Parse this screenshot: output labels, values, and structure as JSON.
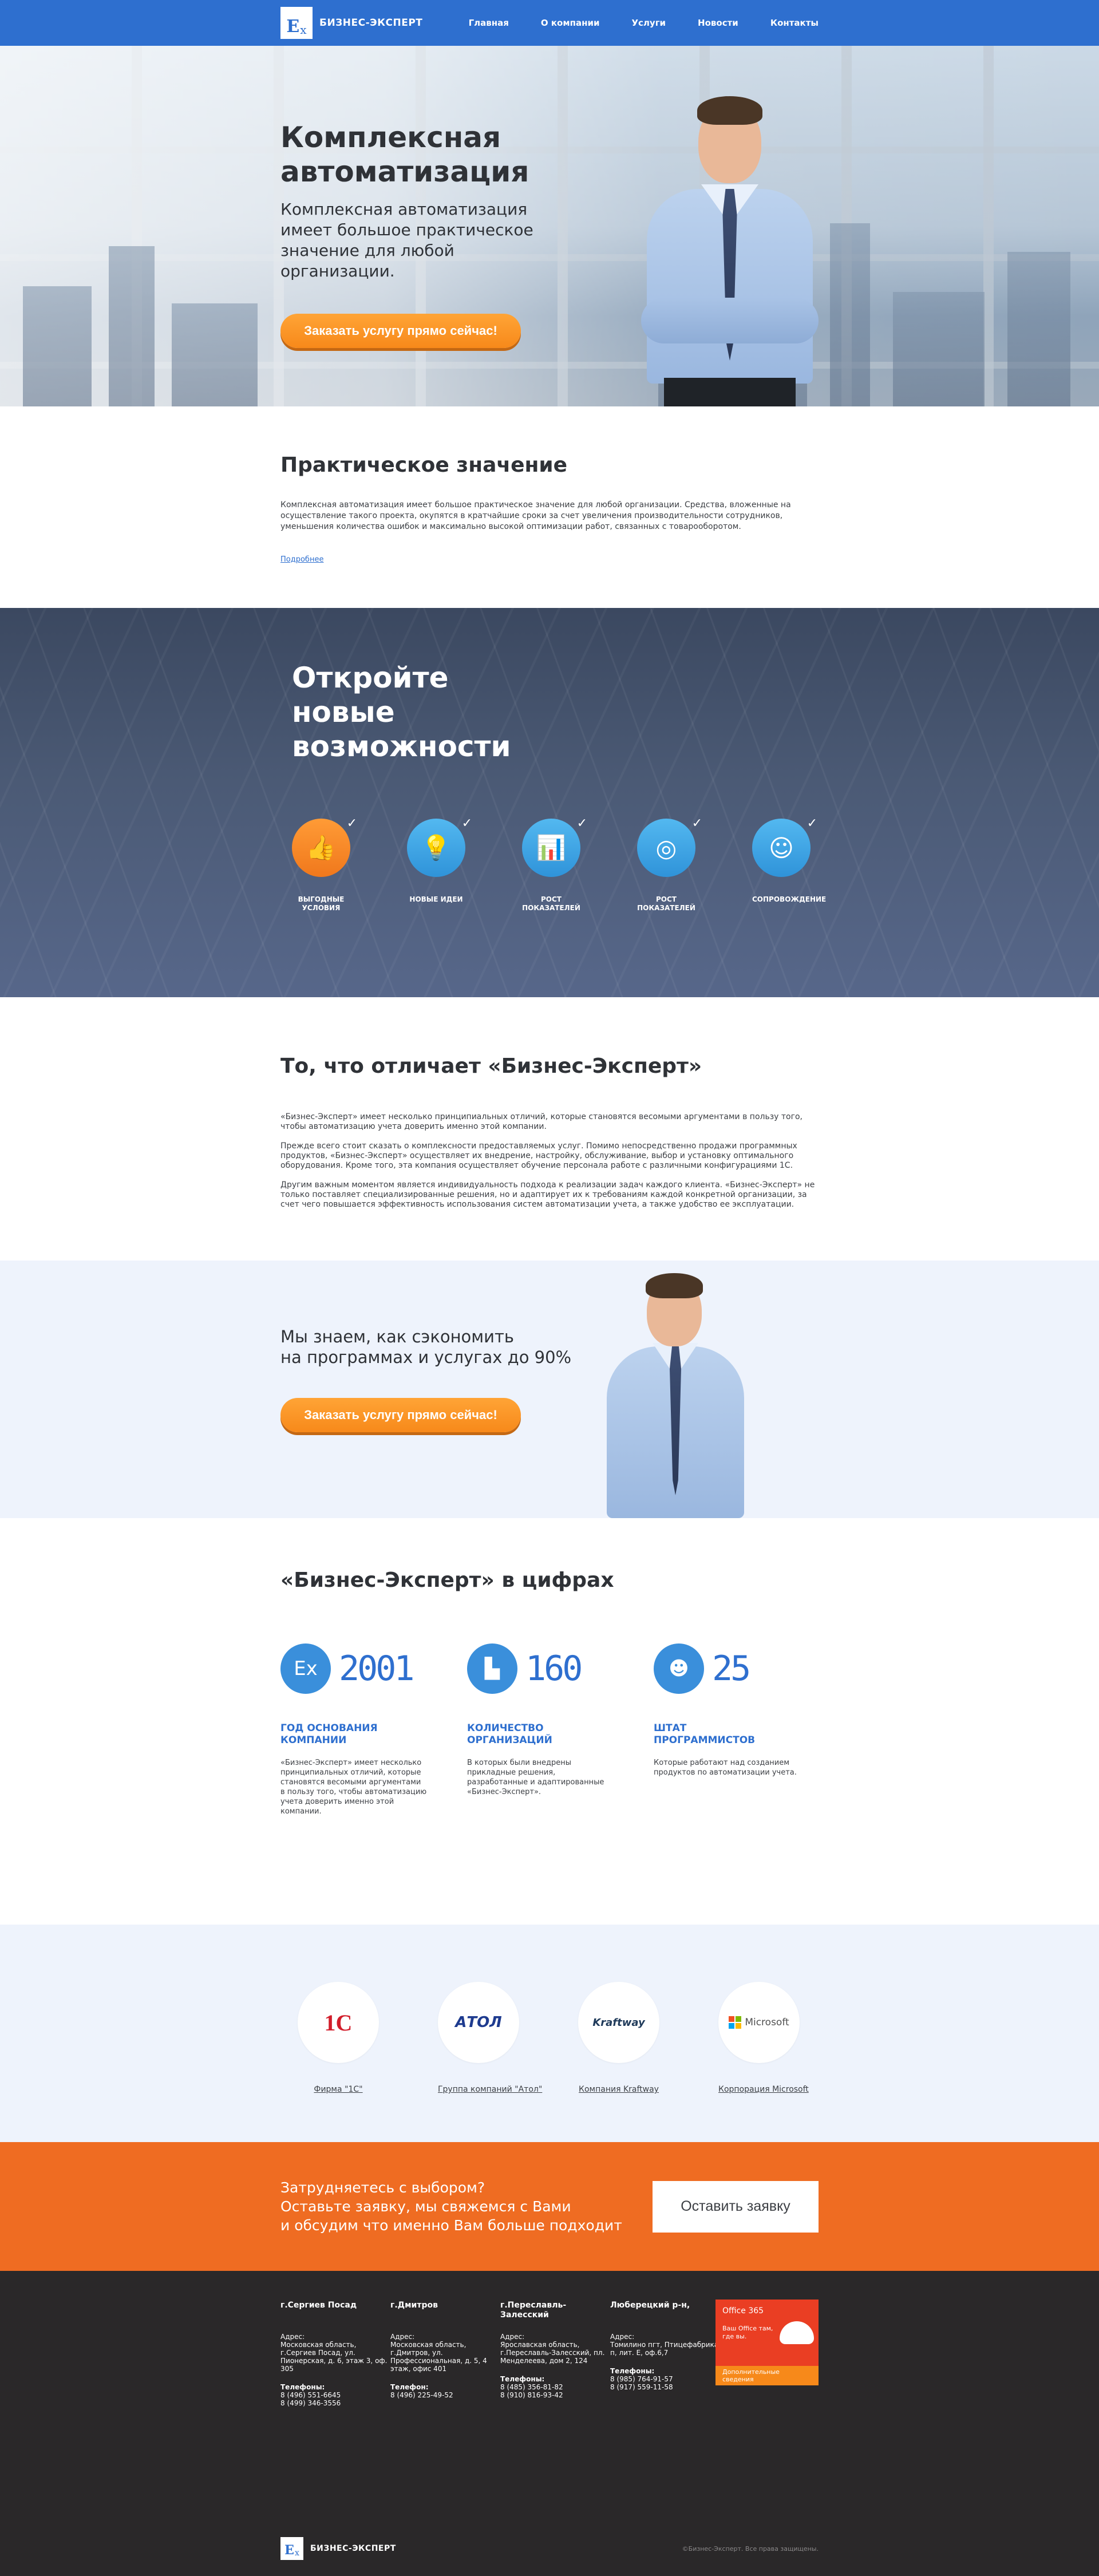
{
  "header": {
    "logo_mark": "E",
    "logo_sub": "x",
    "brand": "БИЗНЕС-ЭКСПЕРТ",
    "nav": [
      "Главная",
      "О компании",
      "Услуги",
      "Новости",
      "Контакты"
    ]
  },
  "hero": {
    "title_line1": "Комплексная",
    "title_line2": "автоматизация",
    "subtitle": "Комплексная автоматизация имеет большое практическое значение для любой организации.",
    "cta": "Заказать услугу прямо сейчас!"
  },
  "practical": {
    "title": "Практическое значение",
    "text": "Комплексная автоматизация имеет большое практическое значение для любой организации. Средства, вложенные на осуществление такого проекта, окупятся в кратчайшие сроки за счет увеличения производительности сотрудников, уменьшения количества ошибок и максимально высокой оптимизации работ, связанных с товарооборотом.",
    "link": "Подробнее"
  },
  "opportunities": {
    "title_line1": "Откройте",
    "title_line2": "новые",
    "title_line3": "возможности",
    "items": [
      {
        "icon": "thumbs-up-icon",
        "glyph": "👍",
        "label": "Выгодные условия",
        "accent": "#f0781c"
      },
      {
        "icon": "lightbulb-icon",
        "glyph": "💡",
        "label": "Новые идеи",
        "accent": "#2f93d9"
      },
      {
        "icon": "growth-chart-icon",
        "glyph": "📊",
        "label": "Рост показателей",
        "accent": "#2f93d9"
      },
      {
        "icon": "target-icon",
        "glyph": "◎",
        "label": "Рост показателей",
        "accent": "#2f93d9"
      },
      {
        "icon": "support-agent-icon",
        "glyph": "☺",
        "label": "Сопровождение",
        "accent": "#2f93d9"
      }
    ],
    "check": "✓"
  },
  "differences": {
    "title": "То, что отличает «Бизнес-Эксперт»",
    "p1": "«Бизнес-Эксперт» имеет несколько принципиальных отличий, которые становятся весомыми аргументами в пользу того, чтобы автоматизацию учета доверить именно этой компании.",
    "p2": "Прежде всего стоит сказать о комплексности предоставляемых услуг. Помимо непосредственно продажи программных продуктов, «Бизнес-Эксперт» осуществляет их внедрение, настройку, обслуживание, выбор и установку оптимального оборудования. Кроме того, эта компания осуществляет обучение персонала работе с различными конфигурациями 1С.",
    "p3": "Другим важным моментом является индивидуальность подхода к реализации задач каждого клиента. «Бизнес-Эксперт» не только поставляет специализированные решения, но и адаптирует их к требованиям каждой конкретной организации, за счет чего повышается эффективность использования систем автоматизации учета, а также удобство ее эксплуатации."
  },
  "save": {
    "line1": "Мы знаем, как сэкономить",
    "line2": "на программах и услугах до 90%",
    "cta": "Заказать услугу прямо сейчас!"
  },
  "numbers": {
    "title": "«Бизнес-Эксперт» в цифрах",
    "items": [
      {
        "icon": "logo-badge-icon",
        "glyph": "Ex",
        "value": "2001",
        "label_line1": "Год основания",
        "label_line2": "компании",
        "text": "«Бизнес-Эксперт» имеет несколько принципиальных отличий, которые становятся весомыми аргументами в пользу того, чтобы автоматизацию учета доверить именно этой компании."
      },
      {
        "icon": "city-buildings-icon",
        "glyph": "▙",
        "value": "160",
        "label_line1": "Количество",
        "label_line2": "организаций",
        "text": "В которых были внедрены прикладные решения, разработанные и адаптированные «Бизнес-Эксперт»."
      },
      {
        "icon": "staff-person-icon",
        "glyph": "☻",
        "value": "25",
        "label_line1": "Штат",
        "label_line2": "программистов",
        "text": "Которые работают над созданием продуктов по автоматизации учета."
      }
    ]
  },
  "partners": {
    "items": [
      {
        "logo": "1C",
        "name": "Фирма \"1С\""
      },
      {
        "logo": "АТОЛ",
        "name": "Группа компаний \"Атол\""
      },
      {
        "logo": "Kraftway",
        "name": "Компания Kraftway"
      },
      {
        "logo": "Microsoft",
        "name": "Корпорация Microsoft"
      }
    ]
  },
  "cta": {
    "line1": "Затрудняетесь с выбором?",
    "line2": "Оставьте заявку, мы свяжемся с Вами",
    "line3": "и обсудим что именно Вам больше подходит",
    "button": "Оставить заявку"
  },
  "footer": {
    "cols": [
      {
        "city": "г.Сергиев Посад",
        "addr_label": "Адрес:",
        "addr": "Московская область, г.Сергиев Посад, ул. Пионерская, д. 6, этаж 3, оф. 305",
        "tel_label": "Телефоны:",
        "tel1": "8 (496) 551-6645",
        "tel2": "8 (499) 346-3556"
      },
      {
        "city": "г.Дмитров",
        "addr_label": "Адрес:",
        "addr": "Московская область, г.Дмитров, ул. Профессиональная, д. 5, 4 этаж, офис 401",
        "tel_label": "Телефон:",
        "tel1": "8 (496) 225-49-52",
        "tel2": ""
      },
      {
        "city": "г.Переславль-Залесский",
        "addr_label": "Адрес:",
        "addr": "Ярославская область, г.Переславль-Залесский, пл. Менделеева, дом 2, 124",
        "tel_label": "Телефоны:",
        "tel1": "8 (485) 356-81-82",
        "tel2": "8 (910) 816-93-42"
      },
      {
        "city": "Люберецкий р-н,",
        "addr_label": "Адрес:",
        "addr": "Томилино пгт, Птицефабрика п, лит. Е, оф.6,7",
        "tel_label": "Телефоны:",
        "tel1": "8 (985) 764-91-57",
        "tel2": "8 (917) 559-11-58"
      }
    ],
    "office": {
      "title": "Office 365",
      "slogan": "Ваш Office там, где вы.",
      "more": "Дополнительные сведения"
    },
    "brand": "БИЗНЕС-ЭКСПЕРТ",
    "copyright": "©Бизнес-Эксперт. Все права защищены."
  }
}
